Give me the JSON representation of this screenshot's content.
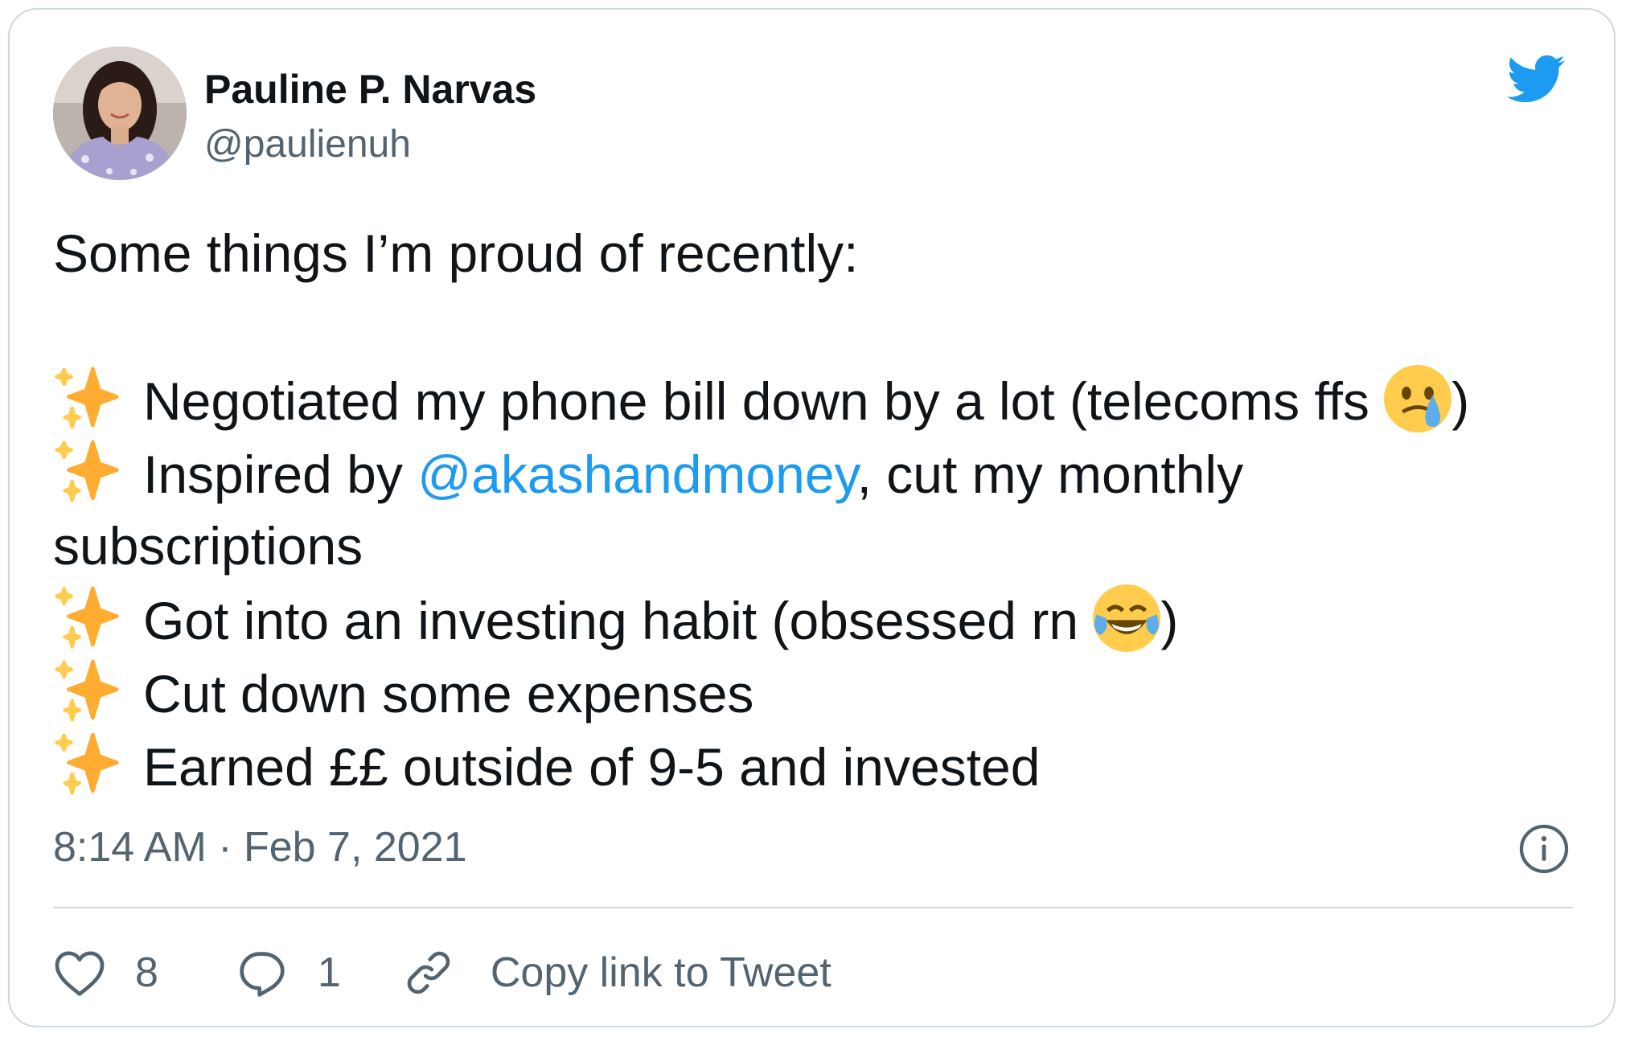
{
  "author": {
    "name": "Pauline P. Narvas",
    "handle": "@paulienuh"
  },
  "tweet": {
    "intro": "Some things I’m proud of recently:",
    "line1": "Negotiated my phone bill down by a lot (telecoms ffs ",
    "line1_end": ")",
    "line2_pre": "Inspired by ",
    "line2_mention": "@akashandmoney",
    "line2_post": ", cut my monthly",
    "line2_wrap": "subscriptions",
    "line3": "Got into an investing habit (obsessed rn ",
    "line3_end": ")",
    "line4": "Cut down some expenses",
    "line5": "Earned ££ outside of 9-5 and invested"
  },
  "meta": {
    "timestamp": "8:14 AM · Feb 7, 2021"
  },
  "actions": {
    "likes": "8",
    "replies": "1",
    "copy_label": "Copy link to Tweet"
  },
  "colors": {
    "accent": "#1d9bf0",
    "secondary_text": "#536471",
    "border": "#cfd9de"
  },
  "icons": [
    "twitter-bird-icon",
    "sparkles-icon",
    "sad-tear-emoji-icon",
    "laughing-tears-emoji-icon",
    "info-icon",
    "heart-icon",
    "reply-bubble-icon",
    "link-icon"
  ]
}
